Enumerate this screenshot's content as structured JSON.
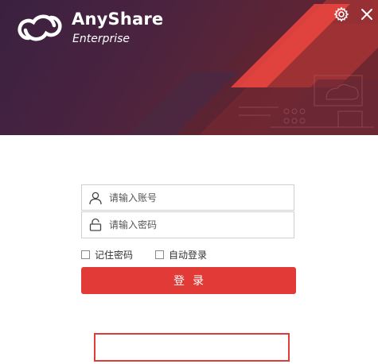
{
  "brand": {
    "name": "AnyShare",
    "edition": "Enterprise"
  },
  "icons": {
    "logo": "cloud-logo-icon",
    "settings": "gear-icon",
    "close": "close-icon",
    "user": "user-icon",
    "lock": "lock-icon"
  },
  "login_form": {
    "username_placeholder": "请输入账号",
    "password_placeholder": "请输入密码",
    "remember_password_label": "记住密码",
    "auto_login_label": "自动登录",
    "submit_label": "登录"
  },
  "colors": {
    "accent": "#e23a36",
    "header_dark": "#3a2140",
    "header_red": "#e8453f"
  }
}
